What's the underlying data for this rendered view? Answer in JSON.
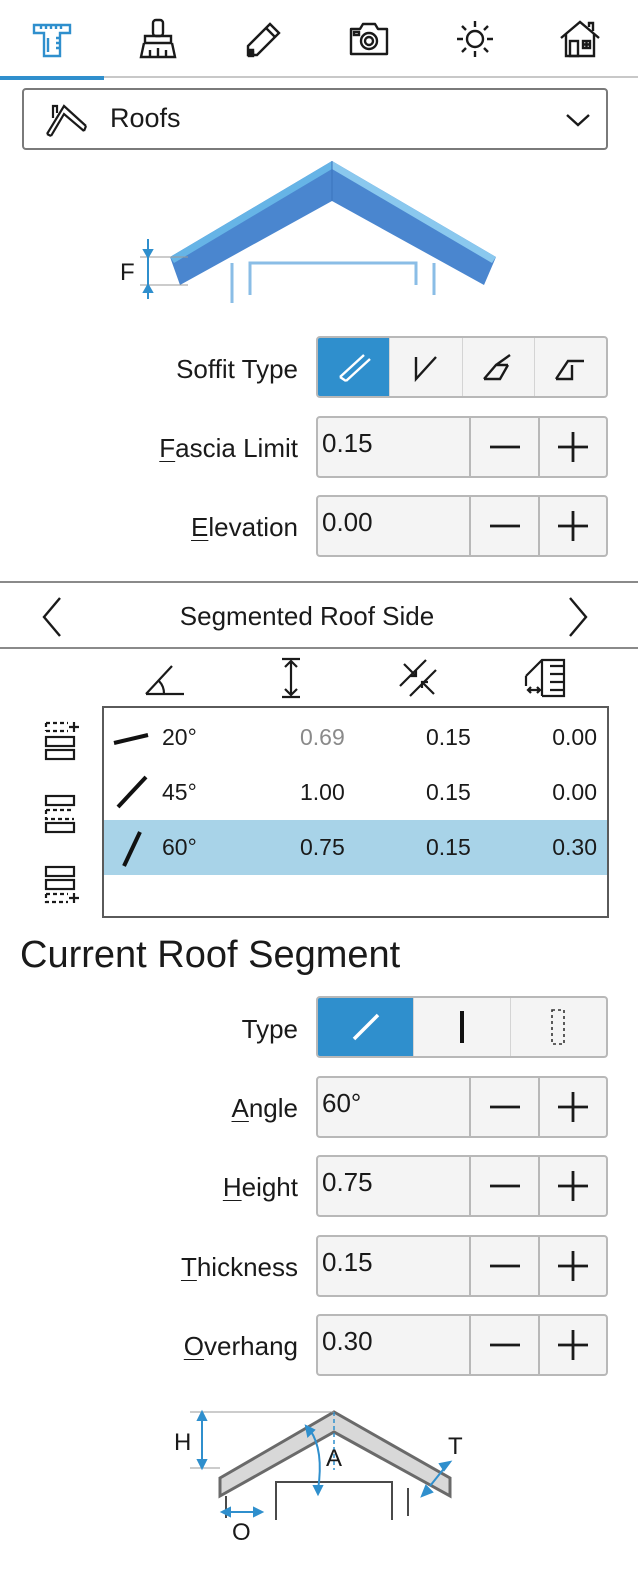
{
  "toolbar": {
    "items": [
      {
        "icon": "measure-ruler-icon",
        "active": true
      },
      {
        "icon": "paint-brush-icon",
        "active": false
      },
      {
        "icon": "pencil-edit-icon",
        "active": false
      },
      {
        "icon": "camera-icon",
        "active": false
      },
      {
        "icon": "sun-icon",
        "active": false
      },
      {
        "icon": "house-icon",
        "active": false
      }
    ],
    "accent": "#2f8fcd"
  },
  "category": {
    "label": "Roofs",
    "icon": "roof-icon"
  },
  "top_diagram": {
    "label_f": "F"
  },
  "fields": {
    "soffit_type": {
      "label": "Soffit Type",
      "selected_index": 0
    },
    "fascia_limit": {
      "label": "Fascia Limit",
      "value": "0.15"
    },
    "elevation": {
      "label": "Elevation",
      "value": "0.00"
    }
  },
  "navigator": {
    "title": "Segmented Roof Side"
  },
  "table": {
    "columns": [
      "angle-icon",
      "height-icon",
      "thickness-icon",
      "overhang-icon"
    ],
    "rows": [
      {
        "angle": "20°",
        "height": "0.69",
        "thickness": "0.15",
        "overhang": "0.00",
        "selected": false,
        "height_muted": true
      },
      {
        "angle": "45°",
        "height": "1.00",
        "thickness": "0.15",
        "overhang": "0.00",
        "selected": false,
        "height_muted": false
      },
      {
        "angle": "60°",
        "height": "0.75",
        "thickness": "0.15",
        "overhang": "0.30",
        "selected": true,
        "height_muted": false
      }
    ],
    "selected_color": "#a8d3e8"
  },
  "segment": {
    "heading": "Current Roof Segment",
    "type": {
      "label": "Type",
      "selected_index": 0
    },
    "angle": {
      "label": "Angle",
      "value": "60°"
    },
    "height": {
      "label": "Height",
      "value": "0.75"
    },
    "thickness": {
      "label": "Thickness",
      "value": "0.15"
    },
    "overhang": {
      "label": "Overhang",
      "value": "0.30"
    }
  },
  "bottom_diagram": {
    "label_h": "H",
    "label_a": "A",
    "label_t": "T",
    "label_o": "O"
  }
}
